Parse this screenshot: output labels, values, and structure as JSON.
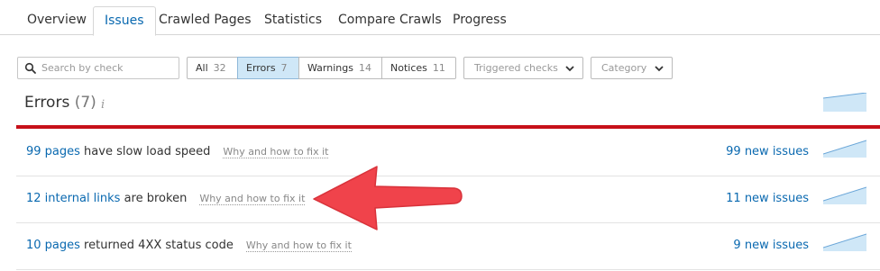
{
  "tabs": [
    {
      "label": "Overview"
    },
    {
      "label": "Issues"
    },
    {
      "label": "Crawled Pages"
    },
    {
      "label": "Statistics"
    },
    {
      "label": "Compare Crawls"
    },
    {
      "label": "Progress"
    }
  ],
  "active_tab": "Issues",
  "search": {
    "placeholder": "Search by check"
  },
  "filters": [
    {
      "label": "All",
      "count": "32"
    },
    {
      "label": "Errors",
      "count": "7"
    },
    {
      "label": "Warnings",
      "count": "14"
    },
    {
      "label": "Notices",
      "count": "11"
    }
  ],
  "active_filter": "Errors",
  "dropdowns": {
    "triggered": "Triggered checks",
    "category": "Category"
  },
  "section": {
    "title": "Errors",
    "count": "(7)",
    "info_icon": "info-icon"
  },
  "issues": [
    {
      "link": "99 pages",
      "text": " have slow load speed",
      "why": "Why and how to fix it",
      "new_issues": "99 new issues"
    },
    {
      "link": "12 internal links",
      "text": " are broken",
      "why": "Why and how to fix it",
      "new_issues": "11 new issues"
    },
    {
      "link": "10 pages",
      "text": " returned 4XX status code",
      "why": "Why and how to fix it",
      "new_issues": "9 new issues"
    }
  ],
  "colors": {
    "accent": "#0a69b0",
    "error_red": "#c7101a",
    "selected_bg": "#cfe7f7",
    "annotation_arrow": "#f0434b"
  }
}
